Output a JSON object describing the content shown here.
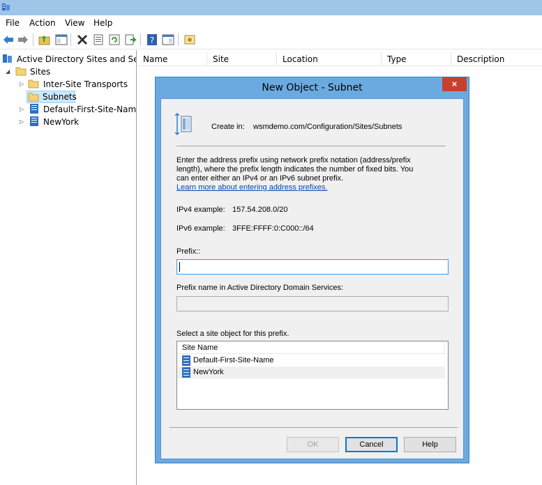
{
  "menu": {
    "file": "File",
    "action": "Action",
    "view": "View",
    "help": "Help"
  },
  "toolbar": {
    "icons": [
      "back-arrow-icon",
      "forward-arrow-icon",
      "up-folder-icon",
      "show-hide-tree-icon",
      "delete-icon",
      "properties-icon",
      "refresh-icon",
      "export-icon",
      "help-icon",
      "console-icon",
      "new-window-icon"
    ]
  },
  "tree": {
    "root": "Active Directory Sites and Servic",
    "sites": "Sites",
    "inter_site_transports": "Inter-Site Transports",
    "subnets": "Subnets",
    "default_first_site": "Default-First-Site-Name",
    "newyork": "NewYork"
  },
  "list": {
    "columns": [
      "Name",
      "Site",
      "Location",
      "Type",
      "Description"
    ]
  },
  "dialog": {
    "title": "New Object - Subnet",
    "close": "×",
    "create_in_label": "Create in:",
    "create_in_path": "wsmdemo.com/Configuration/Sites/Subnets",
    "instructions": [
      "Enter the address prefix using network prefix notation (address/prefix",
      "length), where the prefix length indicates the number of fixed bits. You",
      "can enter either an IPv4 or an IPv6 subnet prefix."
    ],
    "learn_more": "Learn more about entering address prefixes.",
    "ipv4_label": "IPv4 example:",
    "ipv4_value": "157.54.208.0/20",
    "ipv6_label": "IPv6 example:",
    "ipv6_value": "3FFE:FFFF:0:C000::/64",
    "prefix_label": "Prefix::",
    "prefix_value": "",
    "prefix_name_label": "Prefix name in Active Directory Domain Services:",
    "prefix_name_value": "",
    "site_select_label": "Select a site object for this prefix.",
    "site_list_header": "Site Name",
    "sites": [
      "Default-First-Site-Name",
      "NewYork"
    ],
    "ok": "OK",
    "cancel": "Cancel",
    "help": "Help"
  },
  "colors": {
    "titlebar": "#9ec6e8",
    "dialog_frame": "#6baae0",
    "close_button": "#c7402e",
    "selection": "#cce8ff",
    "link": "#0645ad"
  }
}
